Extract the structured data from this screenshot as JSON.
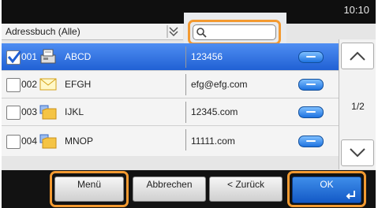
{
  "status": {
    "time": "10:10"
  },
  "header": {
    "title": "Adressbuch (Alle)"
  },
  "search": {
    "placeholder": ""
  },
  "rows": [
    {
      "num": "001",
      "name": "ABCD",
      "address": "123456",
      "icon": "fax-icon",
      "selected": true
    },
    {
      "num": "002",
      "name": "EFGH",
      "address": "efg@efg.com",
      "icon": "email-icon",
      "selected": false
    },
    {
      "num": "003",
      "name": "IJKL",
      "address": "12345.com",
      "icon": "folder-icon",
      "selected": false
    },
    {
      "num": "004",
      "name": "MNOP",
      "address": "11111.com",
      "icon": "folder-icon",
      "selected": false
    }
  ],
  "pager": {
    "page": "1/2"
  },
  "buttons": {
    "menu": "Menü",
    "cancel": "Abbrechen",
    "back": "< Zurück",
    "ok": "OK"
  },
  "colors": {
    "highlight": "#f39a31",
    "selected_row": "#2c6fe0",
    "detail_pill": "#1d72e0"
  }
}
